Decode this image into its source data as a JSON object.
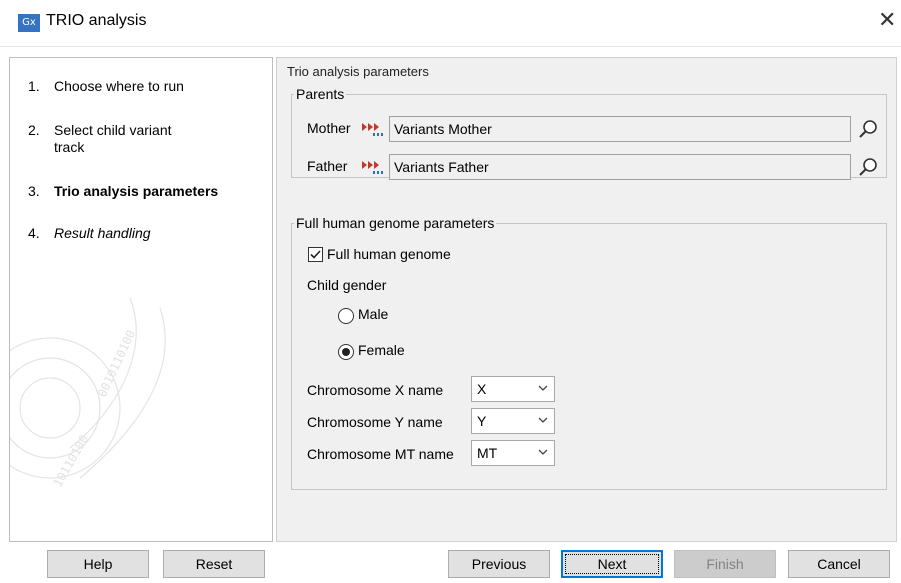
{
  "window": {
    "app_icon": "Gx",
    "title": "TRIO analysis",
    "close_icon": "close-icon"
  },
  "steps": [
    {
      "num": "1.",
      "label": "Choose where to run"
    },
    {
      "num": "2.",
      "label": "Select child variant track"
    },
    {
      "num": "3.",
      "label": "Trio analysis parameters"
    },
    {
      "num": "4.",
      "label": "Result handling"
    }
  ],
  "main": {
    "heading": "Trio analysis parameters",
    "parents": {
      "legend": "Parents",
      "mother_label": "Mother",
      "mother_value": "Variants Mother",
      "father_label": "Father",
      "father_value": "Variants Father"
    },
    "genome": {
      "legend": "Full human genome parameters",
      "full_genome_label": "Full human genome",
      "full_genome_checked": true,
      "child_gender_label": "Child gender",
      "male_label": "Male",
      "female_label": "Female",
      "selected_gender": "Female",
      "chrx_label": "Chromosome X name",
      "chrx_value": "X",
      "chry_label": "Chromosome Y name",
      "chry_value": "Y",
      "chrmt_label": "Chromosome MT name",
      "chrmt_value": "MT"
    }
  },
  "buttons": {
    "help": "Help",
    "reset": "Reset",
    "previous": "Previous",
    "next": "Next",
    "finish": "Finish",
    "cancel": "Cancel"
  },
  "colors": {
    "accent": "#0078d7",
    "track_icon": "#c0392b",
    "app_icon_bg": "#3573c3"
  }
}
